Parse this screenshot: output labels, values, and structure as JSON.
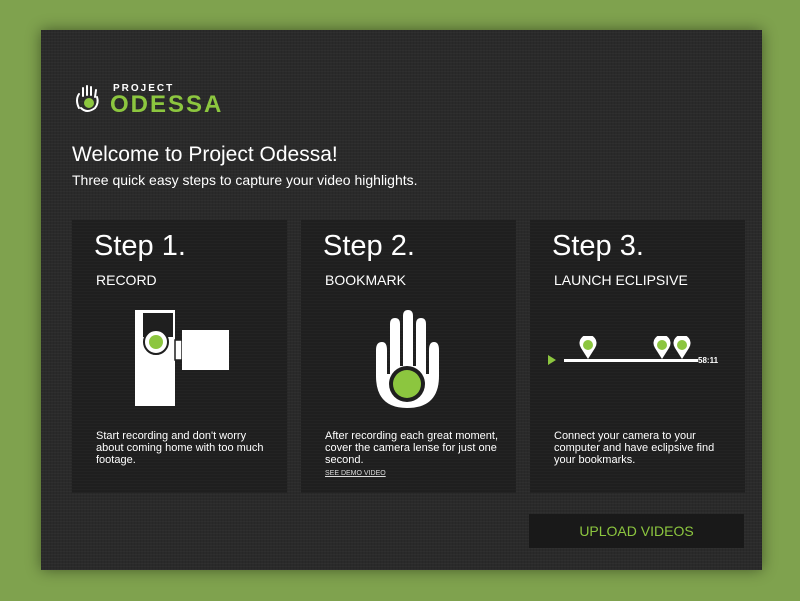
{
  "logo": {
    "top": "PROJECT",
    "bottom": "ODESSA",
    "icon": "hand-logo-icon"
  },
  "header": {
    "title": "Welcome to Project Odessa!",
    "subtitle": "Three quick easy steps to capture your video highlights."
  },
  "steps": [
    {
      "number": "Step 1.",
      "label": "RECORD",
      "icon": "camcorder-icon",
      "description": "Start recording and don't worry about coming home with too much footage."
    },
    {
      "number": "Step 2.",
      "label": "BOOKMARK",
      "icon": "hand-bookmark-icon",
      "description": "After recording each great moment, cover the camera lense for just one second.",
      "link": "SEE DEMO VIDEO"
    },
    {
      "number": "Step 3.",
      "label": "LAUNCH ECLIPSIVE",
      "icon": "timeline-bookmarks-icon",
      "timestamp": "58:11",
      "description": "Connect your camera to your computer and have eclipsive find your bookmarks."
    }
  ],
  "upload_button": "UPLOAD VIDEOS",
  "colors": {
    "accent": "#8cc63f",
    "background": "#7fa24e",
    "panel": "#2a2a2a"
  }
}
